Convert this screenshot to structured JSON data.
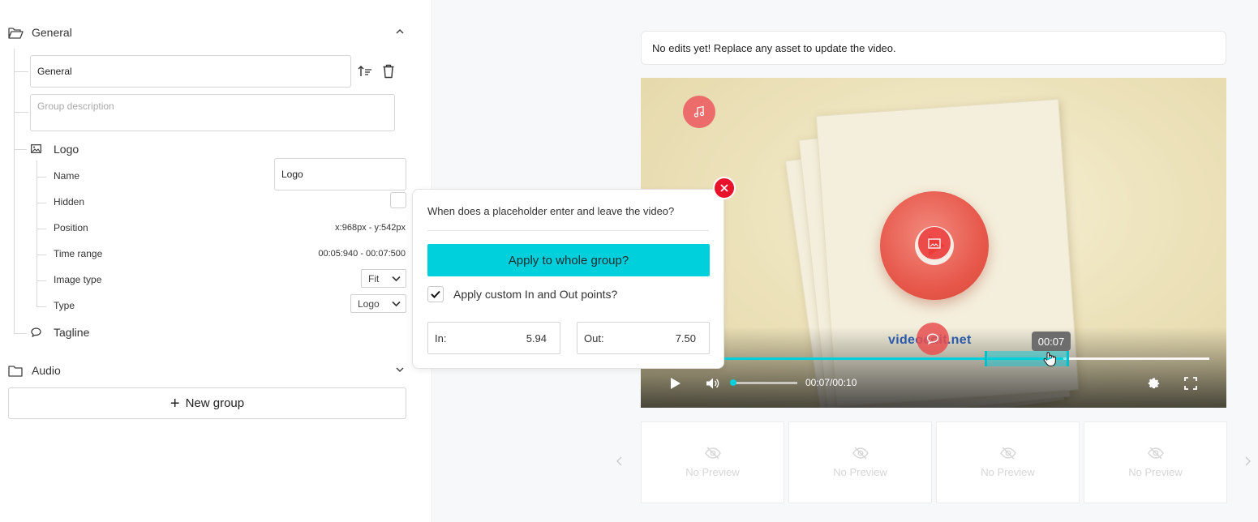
{
  "editor": {
    "groups": [
      {
        "label": "General",
        "state": "expanded"
      },
      {
        "label": "Audio",
        "state": "collapsed"
      }
    ],
    "group_name_value": "General",
    "group_description_placeholder": "Group description",
    "logo": {
      "label": "Logo",
      "name_label": "Name",
      "name_value": "Logo",
      "hidden_label": "Hidden",
      "position_label": "Position",
      "position_value": "x:968px - y:542px",
      "time_range_label": "Time range",
      "time_range_value": "00:05:940 - 00:07:500",
      "image_type_label": "Image type",
      "image_type_value": "Fit",
      "type_label": "Type",
      "type_value": "Logo"
    },
    "tagline_label": "Tagline",
    "new_group_label": "New group"
  },
  "preview": {
    "notice": "No edits yet! Replace any asset to update the video.",
    "watermark": "videoedit.net",
    "time_display": "00:07/00:10",
    "scrub_tooltip": "00:07",
    "progress": 0.7,
    "thumbnails": [
      "No Preview",
      "No Preview",
      "No Preview",
      "No Preview"
    ]
  },
  "popover": {
    "question": "When does a placeholder enter and leave the video?",
    "apply_button": "Apply to whole group?",
    "custom_points_label": "Apply custom In and Out points?",
    "custom_points_checked": true,
    "in_label": "In:",
    "in_value": "5.94",
    "out_label": "Out:",
    "out_value": "7.50"
  },
  "colors": {
    "accent": "#00cfdc",
    "close": "#e8132b",
    "marker": "#ec6b6b"
  }
}
